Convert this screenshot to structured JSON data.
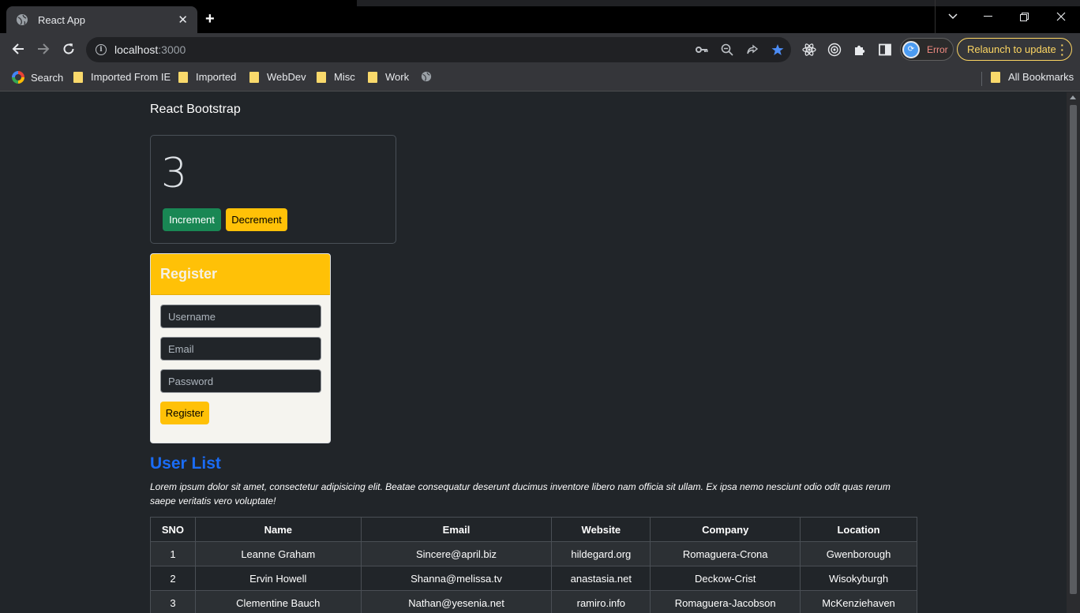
{
  "browser": {
    "tab_title": "React App",
    "url_host": "localhost",
    "url_port": ":3000",
    "profile_status": "Error",
    "relaunch_label": "Relaunch to update",
    "bookmarks": [
      {
        "label": "Search"
      },
      {
        "label": "Imported From IE"
      },
      {
        "label": "Imported"
      },
      {
        "label": "WebDev"
      },
      {
        "label": "Misc"
      },
      {
        "label": "Work"
      }
    ],
    "all_bookmarks_label": "All Bookmarks"
  },
  "page": {
    "brand": "React Bootstrap",
    "counter": {
      "value": "3",
      "increment_label": "Increment",
      "decrement_label": "Decrement"
    },
    "register": {
      "title": "Register",
      "username_placeholder": "Username",
      "email_placeholder": "Email",
      "password_placeholder": "Password",
      "submit_label": "Register"
    },
    "user_list": {
      "title": "User List",
      "description": "Lorem ipsum dolor sit amet, consectetur adipisicing elit. Beatae consequatur deserunt ducimus inventore libero nam officia sit ullam. Ex ipsa nemo nesciunt odio odit quas rerum saepe veritatis vero voluptate!",
      "columns": [
        "SNO",
        "Name",
        "Email",
        "Website",
        "Company",
        "Location"
      ],
      "rows": [
        [
          "1",
          "Leanne Graham",
          "Sincere@april.biz",
          "hildegard.org",
          "Romaguera-Crona",
          "Gwenborough"
        ],
        [
          "2",
          "Ervin Howell",
          "Shanna@melissa.tv",
          "anastasia.net",
          "Deckow-Crist",
          "Wisokyburgh"
        ],
        [
          "3",
          "Clementine Bauch",
          "Nathan@yesenia.net",
          "ramiro.info",
          "Romaguera-Jacobson",
          "McKenziehaven"
        ]
      ]
    }
  },
  "colors": {
    "success": "#198754",
    "warning": "#ffc107",
    "link_blue": "#1a6cf5",
    "page_bg": "#212529"
  }
}
